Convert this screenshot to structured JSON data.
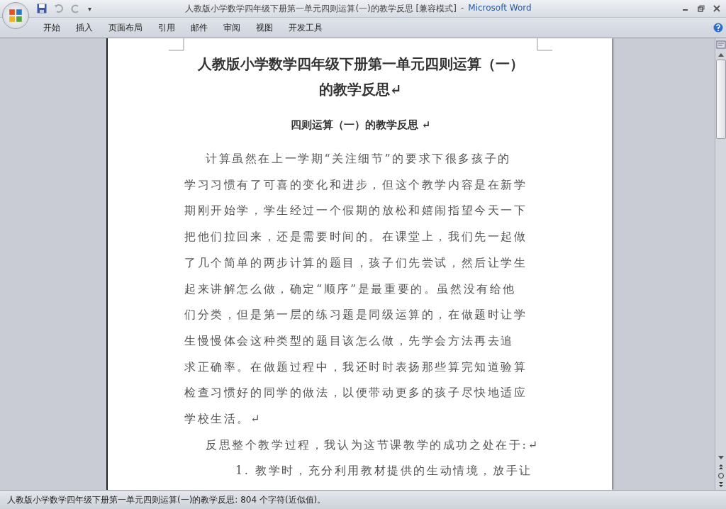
{
  "window": {
    "title": "人教版小学数学四年级下册第一单元四则运算(一)的教学反思 [兼容模式]",
    "separator": "-",
    "app_name": "Microsoft Word",
    "quick_access": {
      "more": "▾"
    }
  },
  "tabs": [
    {
      "label": "开始",
      "selected": false
    },
    {
      "label": "插入",
      "selected": false
    },
    {
      "label": "页面布局",
      "selected": false
    },
    {
      "label": "引用",
      "selected": false
    },
    {
      "label": "邮件",
      "selected": false
    },
    {
      "label": "审阅",
      "selected": false
    },
    {
      "label": "视图",
      "selected": false
    },
    {
      "label": "开发工具",
      "selected": false
    }
  ],
  "document": {
    "title_lines": [
      "人教版小学数学四年级下册第一单元四则运算（一）",
      "的教学反思↵"
    ],
    "subtitle": "四则运算（一）的教学反思 ↵",
    "paragraphs": [
      {
        "kind": "body",
        "lines": [
          "计算虽然在上一学期“关注细节”的要求下很多孩子的",
          "学习习惯有了可喜的变化和进步，但这个教学内容是在新学",
          "期刚开始学，学生经过一个假期的放松和嬉闹指望今天一下",
          "把他们拉回来，还是需要时间的。在课堂上，我们先一起做",
          "了几个简单的两步计算的题目，孩子们先尝试，然后让学生",
          "起来讲解怎么做，确定“顺序”是最重要的。虽然没有给他",
          "们分类，但是第一层的练习题是同级运算的，在做题时让学",
          "生慢慢体会这种类型的题目该怎么做，先学会方法再去追",
          "求正确率。在做题过程中，我还时时表扬那些算完知道验算",
          "检查习惯好的同学的做法，以便带动更多的孩子尽快地适应",
          "学校生活。↵"
        ]
      },
      {
        "kind": "body",
        "lines": [
          "反思整个教学过程，我认为这节课教学的成功之处在于:↵"
        ]
      },
      {
        "kind": "list",
        "lines": [
          "1. 教学时，充分利用教材提供的生动情境，放手让"
        ]
      }
    ]
  },
  "status_bar": {
    "text": "人教版小学数学四年级下册第一单元四则运算(一)的教学反思: 804 个字符(近似值)。"
  }
}
